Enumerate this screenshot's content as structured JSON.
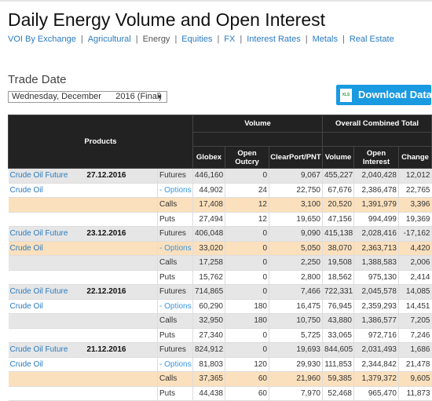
{
  "title": "Daily Energy Volume and Open Interest",
  "nav": [
    {
      "label": "VOI By Exchange",
      "current": false
    },
    {
      "label": "Agricultural",
      "current": false
    },
    {
      "label": "Energy",
      "current": true
    },
    {
      "label": "Equities",
      "current": false
    },
    {
      "label": "FX",
      "current": false
    },
    {
      "label": "Interest Rates",
      "current": false
    },
    {
      "label": "Metals",
      "current": false
    },
    {
      "label": "Real Estate",
      "current": false
    }
  ],
  "trade_date": {
    "label": "Trade Date",
    "selected": "Wednesday, December      2016 (Final)"
  },
  "download": {
    "label": "Download Data",
    "icon": "xls-icon",
    "icon_text": "XLS",
    "color": "#1a9ae0"
  },
  "table": {
    "headers": {
      "products": "Products",
      "volume": "Volume",
      "overall": "Overall Combined Total",
      "globex": "Globex",
      "open_outcry": "Open Outcry",
      "clearport": "ClearPort/PNT",
      "volume_col": "Volume",
      "open_interest": "Open Interest",
      "change": "Change"
    },
    "groups": [
      {
        "date": "27.12.2016",
        "rows": [
          {
            "product": "Crude Oil Future",
            "type": "Futures",
            "style": "gray",
            "vals": [
              "446,160",
              "0",
              "9,067",
              "455,227",
              "2,040,428",
              "12,012"
            ]
          },
          {
            "product": "Crude Oil",
            "type": "- Options",
            "style": "white",
            "vals": [
              "44,902",
              "24",
              "22,750",
              "67,676",
              "2,386,478",
              "22,765"
            ]
          },
          {
            "product": "",
            "type": "Calls",
            "style": "peach",
            "vals": [
              "17,408",
              "12",
              "3,100",
              "20,520",
              "1,391,979",
              "3,396"
            ]
          },
          {
            "product": "",
            "type": "Puts",
            "style": "white",
            "vals": [
              "27,494",
              "12",
              "19,650",
              "47,156",
              "994,499",
              "19,369"
            ]
          }
        ]
      },
      {
        "date": "23.12.2016",
        "rows": [
          {
            "product": "Crude Oil Future",
            "type": "Futures",
            "style": "gray",
            "vals": [
              "406,048",
              "0",
              "9,090",
              "415,138",
              "2,028,416",
              "-17,162"
            ]
          },
          {
            "product": "Crude Oil",
            "type": "- Options",
            "style": "peach",
            "vals": [
              "33,020",
              "0",
              "5,050",
              "38,070",
              "2,363,713",
              "4,420"
            ]
          },
          {
            "product": "",
            "type": "Calls",
            "style": "gray",
            "vals": [
              "17,258",
              "0",
              "2,250",
              "19,508",
              "1,388,583",
              "2,006"
            ]
          },
          {
            "product": "",
            "type": "Puts",
            "style": "white",
            "vals": [
              "15,762",
              "0",
              "2,800",
              "18,562",
              "975,130",
              "2,414"
            ]
          }
        ]
      },
      {
        "date": "22.12.2016",
        "rows": [
          {
            "product": "Crude Oil Future",
            "type": "Futures",
            "style": "gray",
            "vals": [
              "714,865",
              "0",
              "7,466",
              "722,331",
              "2,045,578",
              "14,085"
            ]
          },
          {
            "product": "Crude Oil",
            "type": "- Options",
            "style": "white",
            "vals": [
              "60,290",
              "180",
              "16,475",
              "76,945",
              "2,359,293",
              "14,451"
            ]
          },
          {
            "product": "",
            "type": "Calls",
            "style": "gray",
            "vals": [
              "32,950",
              "180",
              "10,750",
              "43,880",
              "1,386,577",
              "7,205"
            ]
          },
          {
            "product": "",
            "type": "Puts",
            "style": "white",
            "vals": [
              "27,340",
              "0",
              "5,725",
              "33,065",
              "972,716",
              "7,246"
            ]
          }
        ]
      },
      {
        "date": "21.12.2016",
        "rows": [
          {
            "product": "Crude Oil Future",
            "type": "Futures",
            "style": "gray",
            "vals": [
              "824,912",
              "0",
              "19,693",
              "844,605",
              "2,031,493",
              "1,686"
            ]
          },
          {
            "product": "Crude Oil",
            "type": "- Options",
            "style": "white",
            "vals": [
              "81,803",
              "120",
              "29,930",
              "111,853",
              "2,344,842",
              "21,478"
            ]
          },
          {
            "product": "",
            "type": "Calls",
            "style": "peach",
            "vals": [
              "37,365",
              "60",
              "21,960",
              "59,385",
              "1,379,372",
              "9,605"
            ]
          },
          {
            "product": "",
            "type": "Puts",
            "style": "white",
            "vals": [
              "44,438",
              "60",
              "7,970",
              "52,468",
              "965,470",
              "11,873"
            ]
          }
        ]
      }
    ]
  }
}
